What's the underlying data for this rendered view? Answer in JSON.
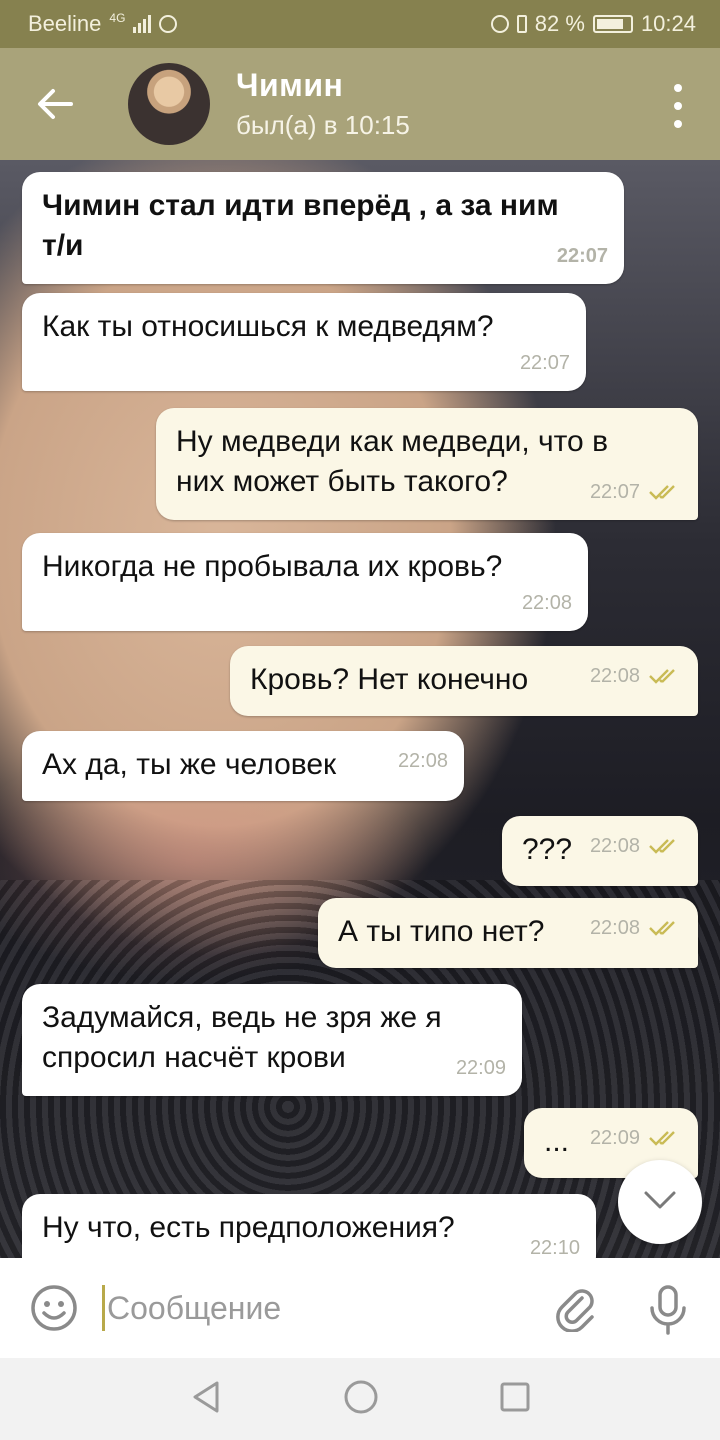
{
  "status_bar": {
    "carrier": "Beeline",
    "network": "4G",
    "battery": "82 %",
    "time": "10:24"
  },
  "header": {
    "contact_name": "Чимин",
    "last_seen": "был(а) в 10:15"
  },
  "messages": [
    {
      "dir": "in",
      "text": "Чимин стал идти вперёд , а за ним т/и",
      "time": "22:07"
    },
    {
      "dir": "in",
      "text": "Как ты относишься к медведям?",
      "time": "22:07"
    },
    {
      "dir": "out",
      "text": "Ну медведи как медведи, что в них может быть такого?",
      "time": "22:07"
    },
    {
      "dir": "in",
      "text": "Никогда не пробывала их кровь?",
      "time": "22:08"
    },
    {
      "dir": "out",
      "text": "Кровь? Нет конечно",
      "time": "22:08"
    },
    {
      "dir": "in",
      "text": "Ах да, ты же человек",
      "time": "22:08"
    },
    {
      "dir": "out",
      "text": "???",
      "time": "22:08"
    },
    {
      "dir": "out",
      "text": "А ты типо нет?",
      "time": "22:08"
    },
    {
      "dir": "in",
      "text": "Задумайся, ведь не зря же я спросил насчёт крови",
      "time": "22:09"
    },
    {
      "dir": "out",
      "text": "...",
      "time": "22:09"
    },
    {
      "dir": "in",
      "text": "Ну что, есть предположения?",
      "time": "22:10"
    }
  ],
  "input": {
    "placeholder": "Сообщение"
  },
  "colors": {
    "header": "#a9a37a",
    "status_bar": "#86814f",
    "incoming_bubble": "#ffffff",
    "outgoing_bubble": "#fbf7e6",
    "read_check": "#c9bb55"
  },
  "icons": [
    "back-arrow-icon",
    "more-vert-icon",
    "double-check-icon",
    "chevron-down-icon",
    "emoji-icon",
    "attach-icon",
    "mic-icon",
    "nav-back-icon",
    "nav-home-icon",
    "nav-recents-icon"
  ]
}
